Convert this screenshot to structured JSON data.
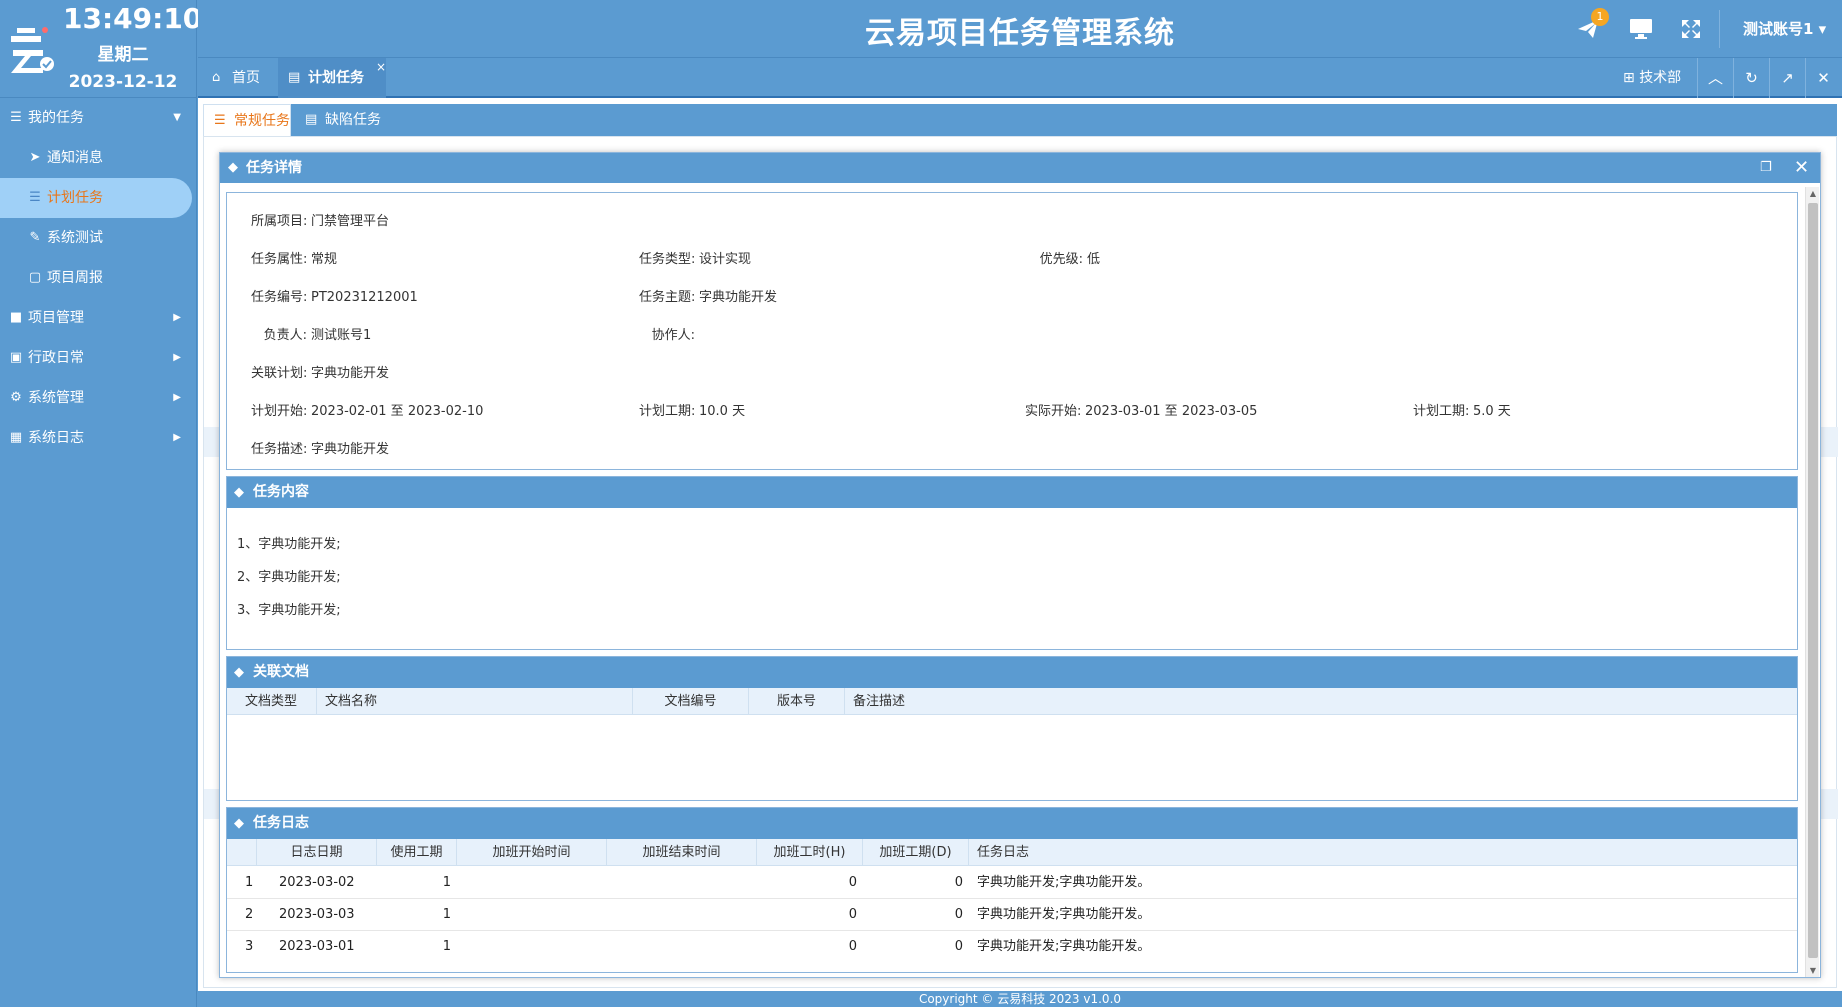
{
  "clock": {
    "time": "13:49:10",
    "weekday": "星期二",
    "date": "2023-12-12"
  },
  "header": {
    "title": "云易项目任务管理系统",
    "badge_count": "1",
    "user": "测试账号1 ▾"
  },
  "sidebar": {
    "sections": [
      {
        "label": "我的任务",
        "icon": "list-icon",
        "expanded": true
      },
      {
        "label": "项目管理",
        "icon": "folder-icon"
      },
      {
        "label": "行政日常",
        "icon": "badge-icon"
      },
      {
        "label": "系统管理",
        "icon": "gears-icon"
      },
      {
        "label": "系统日志",
        "icon": "calendar-grid-icon"
      }
    ],
    "sub_items": [
      {
        "label": "通知消息",
        "icon": "paper-plane-icon"
      },
      {
        "label": "计划任务",
        "icon": "list-icon",
        "active": true
      },
      {
        "label": "系统测试",
        "icon": "pencil-icon"
      },
      {
        "label": "项目周报",
        "icon": "calendar-icon"
      }
    ]
  },
  "tabbar": {
    "home": "首页",
    "plan": "计划任务",
    "close": "×",
    "dept": "技术部"
  },
  "subtabs": {
    "regular": "常规任务",
    "defect": "缺陷任务"
  },
  "modal": {
    "title": "任务详情",
    "info": {
      "project_label": "所属项目:",
      "project": "门禁管理平台",
      "attr_label": "任务属性:",
      "attr": "常规",
      "type_label": "任务类型:",
      "type": "设计实现",
      "priority_label": "优先级:",
      "priority": "低",
      "no_label": "任务编号:",
      "no": "PT20231212001",
      "subject_label": "任务主题:",
      "subject": "字典功能开发",
      "owner_label": "负责人:",
      "owner": "测试账号1",
      "assist_label": "协作人:",
      "assist": "",
      "plan_link_label": "关联计划:",
      "plan_link": "字典功能开发",
      "plan_start_label": "计划开始:",
      "plan_start": "2023-02-01 至 2023-02-10",
      "plan_days_label": "计划工期:",
      "plan_days": "10.0 天",
      "actual_start_label": "实际开始:",
      "actual_start": "2023-03-01 至 2023-03-05",
      "plan_days2_label": "计划工期:",
      "plan_days2": "5.0 天",
      "desc_label": "任务描述:",
      "desc": "字典功能开发"
    },
    "content": {
      "title": "任务内容",
      "lines": [
        "1、字典功能开发;",
        "2、字典功能开发;",
        "3、字典功能开发;"
      ]
    },
    "docs": {
      "title": "关联文档",
      "headers": [
        "文档类型",
        "文档名称",
        "文档编号",
        "版本号",
        "备注描述"
      ]
    },
    "log": {
      "title": "任务日志",
      "headers": [
        "日志日期",
        "使用工期",
        "加班开始时间",
        "加班结束时间",
        "加班工时(H)",
        "加班工期(D)",
        "任务日志"
      ],
      "rows": [
        {
          "idx": "1",
          "date": "2023-03-02",
          "used": "1",
          "ot_start": "",
          "ot_end": "",
          "ot_hours": "0",
          "ot_days": "0",
          "log": "字典功能开发;字典功能开发。"
        },
        {
          "idx": "2",
          "date": "2023-03-03",
          "used": "1",
          "ot_start": "",
          "ot_end": "",
          "ot_hours": "0",
          "ot_days": "0",
          "log": "字典功能开发;字典功能开发。"
        },
        {
          "idx": "3",
          "date": "2023-03-01",
          "used": "1",
          "ot_start": "",
          "ot_end": "",
          "ot_hours": "0",
          "ot_days": "0",
          "log": "字典功能开发;字典功能开发。"
        }
      ]
    }
  },
  "footer": {
    "copyright": "Copyright © 云易科技 2023 v1.0.0"
  },
  "colors": {
    "primary": "#5b9bd1",
    "active_text": "#e8761a",
    "active_bg": "#9fd0f7",
    "badge": "#f5a623"
  }
}
